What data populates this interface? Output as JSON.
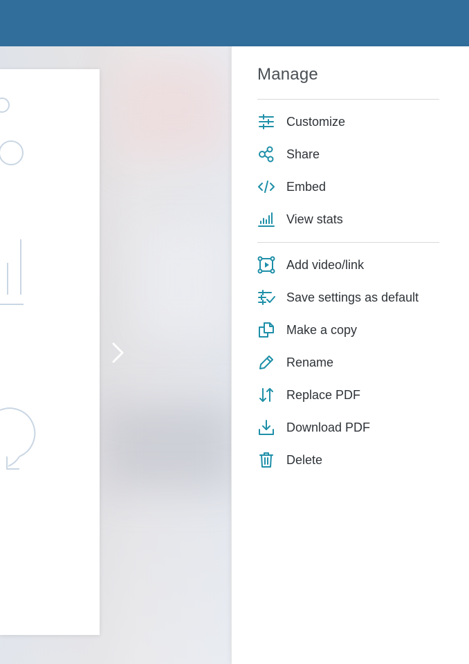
{
  "panel": {
    "title": "Manage",
    "group1": [
      {
        "label": "Customize",
        "icon": "sliders-icon"
      },
      {
        "label": "Share",
        "icon": "share-icon"
      },
      {
        "label": "Embed",
        "icon": "code-icon"
      },
      {
        "label": "View stats",
        "icon": "bar-chart-icon"
      }
    ],
    "group2": [
      {
        "label": "Add video/link",
        "icon": "add-video-icon"
      },
      {
        "label": "Save settings as default",
        "icon": "settings-check-icon"
      },
      {
        "label": "Make a copy",
        "icon": "copy-icon"
      },
      {
        "label": "Rename",
        "icon": "pencil-icon"
      },
      {
        "label": "Replace PDF",
        "icon": "swap-arrows-icon"
      },
      {
        "label": "Download PDF",
        "icon": "download-icon"
      },
      {
        "label": "Delete",
        "icon": "trash-icon"
      }
    ]
  },
  "colors": {
    "header": "#316e9b",
    "accent": "#1e8fa8"
  }
}
